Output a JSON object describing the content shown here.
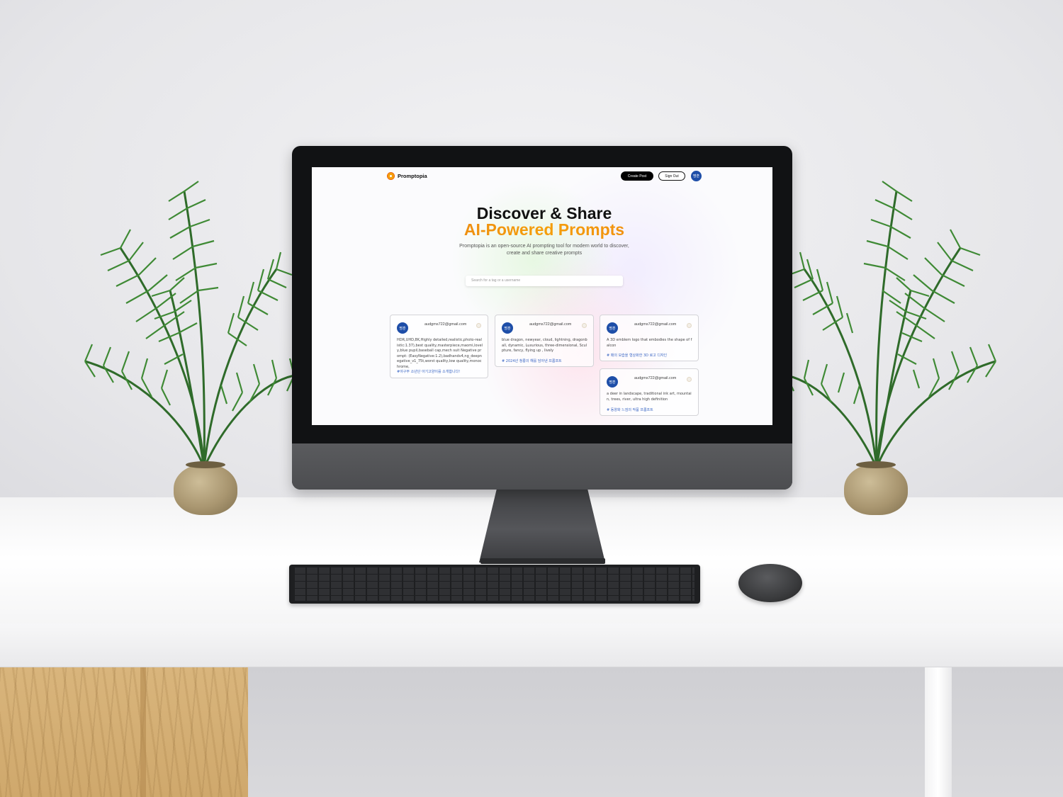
{
  "nav": {
    "brand": "Promptopia",
    "create_label": "Create Post",
    "signout_label": "Sign Out",
    "avatar_text": "명훈"
  },
  "hero": {
    "title_line1": "Discover & Share",
    "title_line2": "AI-Powered Prompts",
    "description": "Promptopia is an open-source AI prompting tool for modern world to discover, create and share creative prompts"
  },
  "search": {
    "placeholder": "Search for a tag or a username"
  },
  "posts": [
    {
      "avatar_text": "명훈",
      "email": "audgms722@gmail.com",
      "prompt": "HDR,UHD,8K,Highly detailed,realistic,photo-realistic:1.37),best quality,masterpiece,maomi,lovely,blue pupil,baseball cap,mech suit Negative prompt: (EasyNegative:1.2),badhandv4,ng_deepnegative_v1_75t,worst quality,low quality,monochrome,",
      "tag": "#야구부 소년단 아기고양이를 소개합니다!"
    },
    {
      "avatar_text": "명훈",
      "email": "audgms722@gmail.com",
      "prompt": "blue dragon, newyear, cloud, lightning, dragonball, dynamic, Luxurious, three-dimensional, Sculpture, fancy, flying up , lively",
      "tag": "# 2024년 청룡의 해를 담아낸 프롬프트"
    },
    {
      "avatar_text": "명훈",
      "email": "audgms722@gmail.com",
      "prompt": "A 3D emblem logo that embodies the shape of falcon",
      "tag": "# 매의 모습을 형상화한 3D 로고 디자인"
    },
    {
      "avatar_text": "명훈",
      "email": "audgms722@gmail.com",
      "prompt": "a deer in landscape, traditional ink art, mountain, trees, river, ultra high definition",
      "tag": "# 동양화 느낌의 작품 프롬프트"
    }
  ],
  "colors": {
    "accent_orange": "#f08a1c",
    "avatar_blue": "#1e4ea8",
    "tag_blue": "#3a66c4"
  }
}
